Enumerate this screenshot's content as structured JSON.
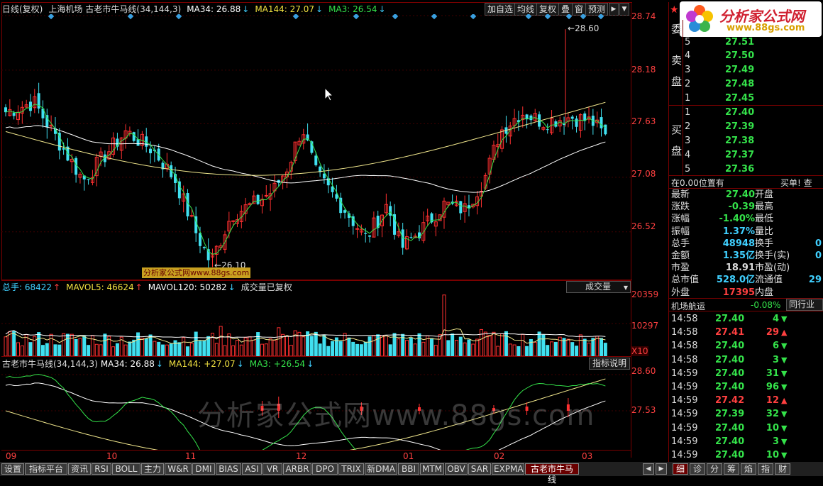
{
  "main": {
    "header": {
      "period": "日线(复权)",
      "stock": "上海机场",
      "indicator": "古老市牛马线(34,144,3)",
      "ma34": "MA34: 26.88",
      "ma144": "MA144: 27.07",
      "ma3": "MA3: 26.54"
    },
    "axis": [
      "28.74",
      "28.18",
      "27.63",
      "27.08",
      "26.52"
    ],
    "high_label": "28.60",
    "low_label": "26.10",
    "watermark_small": "分析家公式网www.88gs.com"
  },
  "toolbar": {
    "add_watch": "加自选",
    "ma": "均线",
    "adjust": "复权",
    "overlay": "叠",
    "window": "窗",
    "predict": "预测"
  },
  "volume": {
    "header": {
      "total": "总手: 68422",
      "mavol5": "MAVOL5: 46624",
      "mavol120": "MAVOL120: 50282",
      "note": "成交量已复权"
    },
    "dropdown": "成交量",
    "axis": [
      "20359",
      "10297"
    ],
    "unit": "X10"
  },
  "indicator": {
    "header": {
      "name": "古老市牛马线(34,144,3)",
      "ma34": "MA34: 26.88",
      "ma144": "MA144: +27.07",
      "ma3": "MA3: +26.54"
    },
    "help": "指标说明",
    "axis": [
      "28.60",
      "27.53"
    ]
  },
  "watermark": "分析家公式网www.88gs.com",
  "months": [
    "09",
    "10",
    "11",
    "12",
    "01",
    "02",
    "03"
  ],
  "logo": {
    "title": "分析家公式网",
    "url": "www.88gs.com"
  },
  "orderbook": {
    "committee_label": "委",
    "sell_label": [
      "卖",
      "盘"
    ],
    "buy_label": [
      "买",
      "盘"
    ],
    "sell": [
      {
        "lvl": "5",
        "price": "27.51"
      },
      {
        "lvl": "4",
        "price": "27.50"
      },
      {
        "lvl": "3",
        "price": "27.49"
      },
      {
        "lvl": "2",
        "price": "27.48"
      },
      {
        "lvl": "1",
        "price": "27.45"
      }
    ],
    "buy": [
      {
        "lvl": "1",
        "price": "27.40"
      },
      {
        "lvl": "2",
        "price": "27.39"
      },
      {
        "lvl": "3",
        "price": "27.38"
      },
      {
        "lvl": "4",
        "price": "27.37"
      },
      {
        "lvl": "5",
        "price": "27.36"
      }
    ],
    "position": "在0.00位置有",
    "buy_check": "买单! 查"
  },
  "quote": [
    {
      "l": "最新",
      "v": "27.40",
      "c": "#34e24a",
      "r": "开盘"
    },
    {
      "l": "涨跌",
      "v": "-0.39",
      "c": "#34e24a",
      "r": "最高"
    },
    {
      "l": "涨幅",
      "v": "-1.40%",
      "c": "#34e24a",
      "r": "最低"
    },
    {
      "l": "振幅",
      "v": "1.37%",
      "c": "#40d0ff",
      "r": "量比"
    },
    {
      "l": "总手",
      "v": "48948",
      "c": "#40d0ff",
      "r": "换手"
    },
    {
      "l": "金额",
      "v": "1.35亿",
      "c": "#40d0ff",
      "r": "换手(实)"
    },
    {
      "l": "市盈",
      "v": "18.91",
      "c": "#dddddd",
      "r": "市盈(动)"
    },
    {
      "l": "总市值",
      "v": "528.0亿",
      "c": "#40d0ff",
      "r": "流通值"
    },
    {
      "l": "外盘",
      "v": "17395",
      "c": "#ff4040",
      "r": "内盘"
    }
  ],
  "quote_right_vals": [
    "",
    "",
    "",
    "",
    "0",
    "0",
    "",
    "29",
    ""
  ],
  "industry": {
    "name": "机场航运",
    "change": "-0.08%",
    "tab": "同行业"
  },
  "ticks": [
    {
      "t": "14:58",
      "p": "27.40",
      "v": "4",
      "c": "#34e24a",
      "a": "▼"
    },
    {
      "t": "14:58",
      "p": "27.41",
      "v": "29",
      "c": "#ff4040",
      "a": "▲"
    },
    {
      "t": "14:58",
      "p": "27.40",
      "v": "6",
      "c": "#34e24a",
      "a": "▼"
    },
    {
      "t": "14:58",
      "p": "27.40",
      "v": "3",
      "c": "#34e24a",
      "a": "▼"
    },
    {
      "t": "14:59",
      "p": "27.40",
      "v": "31",
      "c": "#34e24a",
      "a": "▼"
    },
    {
      "t": "14:59",
      "p": "27.40",
      "v": "96",
      "c": "#34e24a",
      "a": "▼"
    },
    {
      "t": "14:59",
      "p": "27.42",
      "v": "12",
      "c": "#ff4040",
      "a": "▲"
    },
    {
      "t": "14:59",
      "p": "27.39",
      "v": "32",
      "c": "#34e24a",
      "a": "▼"
    },
    {
      "t": "14:59",
      "p": "27.40",
      "v": "10",
      "c": "#34e24a",
      "a": "▼"
    },
    {
      "t": "14:59",
      "p": "27.40",
      "v": "3",
      "c": "#34e24a",
      "a": "▼"
    },
    {
      "t": "14:59",
      "p": "27.40",
      "v": "10",
      "c": "#34e24a",
      "a": "▼"
    }
  ],
  "tabs": [
    "设置",
    "指标平台",
    "资讯",
    "RSI",
    "BOLL",
    "主力",
    "W&R",
    "DMI",
    "BIAS",
    "ASI",
    "VR",
    "ARBR",
    "DPO",
    "TRIX",
    "新DMA",
    "BBI",
    "MTM",
    "OBV",
    "SAR",
    "EXPMA",
    "古老市牛马线"
  ],
  "right_tabs": [
    "细",
    "诊",
    "分",
    "筹",
    "焰",
    "指",
    "财"
  ],
  "colors": {
    "up": "#ff3030",
    "down": "#40e0f0",
    "ma34": "#ffffff",
    "ma144": "#f0e68c",
    "ma3": "#34e24a",
    "frame": "#7a0000"
  }
}
